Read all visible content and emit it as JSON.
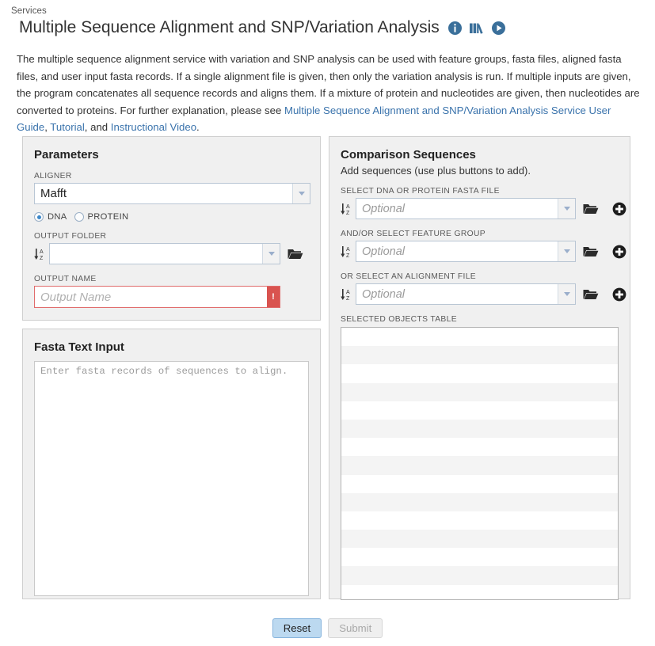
{
  "header": {
    "breadcrumb": "Services",
    "title": "Multiple Sequence Alignment and SNP/Variation Analysis",
    "icons": [
      {
        "name": "info-icon",
        "label": "Information"
      },
      {
        "name": "books-icon",
        "label": "Documentation"
      },
      {
        "name": "play-video-icon",
        "label": "Video"
      }
    ]
  },
  "description": {
    "part1": "The multiple sequence alignment service with variation and SNP analysis can be used with feature groups, fasta files, aligned fasta files, and user input fasta records. If a single alignment file is given, then only the variation analysis is run. If multiple inputs are given, the program concatenates all sequence records and aligns them. If a mixture of protein and nucleotides are given, then nucleotides are converted to proteins. For further explanation, please see ",
    "link1": "Multiple Sequence Alignment and SNP/Variation Analysis Service User Guide",
    "sep1": ", ",
    "link2": "Tutorial",
    "sep2": ", and ",
    "link3": "Instructional Video",
    "end": ".",
    "link_color": "#3a73ac"
  },
  "parameters": {
    "title": "Parameters",
    "aligner_label": "ALIGNER",
    "aligner_value": "Mafft",
    "sequence_type": [
      {
        "label": "DNA",
        "selected": true
      },
      {
        "label": "PROTEIN",
        "selected": false
      }
    ],
    "output_folder_label": "OUTPUT FOLDER",
    "output_folder_value": "",
    "output_name_label": "OUTPUT NAME",
    "output_name_placeholder": "Output Name",
    "output_name_value": "",
    "error_marker": "!",
    "error_color": "#d9534f"
  },
  "fasta": {
    "title": "Fasta Text Input",
    "placeholder": "Enter fasta records of sequences to align.",
    "value": ""
  },
  "comparison": {
    "title": "Comparison Sequences",
    "subtitle": "Add sequences (use plus buttons to add).",
    "rows": [
      {
        "label": "SELECT DNA OR PROTEIN FASTA FILE",
        "placeholder": "Optional",
        "value": ""
      },
      {
        "label": "AND/OR SELECT FEATURE GROUP",
        "placeholder": "Optional",
        "value": ""
      },
      {
        "label": "OR SELECT AN ALIGNMENT FILE",
        "placeholder": "Optional",
        "value": ""
      }
    ],
    "table_label": "SELECTED OBJECTS TABLE",
    "table_rows": 15
  },
  "buttons": {
    "reset": "Reset",
    "submit": "Submit",
    "reset_color": "#bcd9f0",
    "submit_color": "#efefef"
  }
}
